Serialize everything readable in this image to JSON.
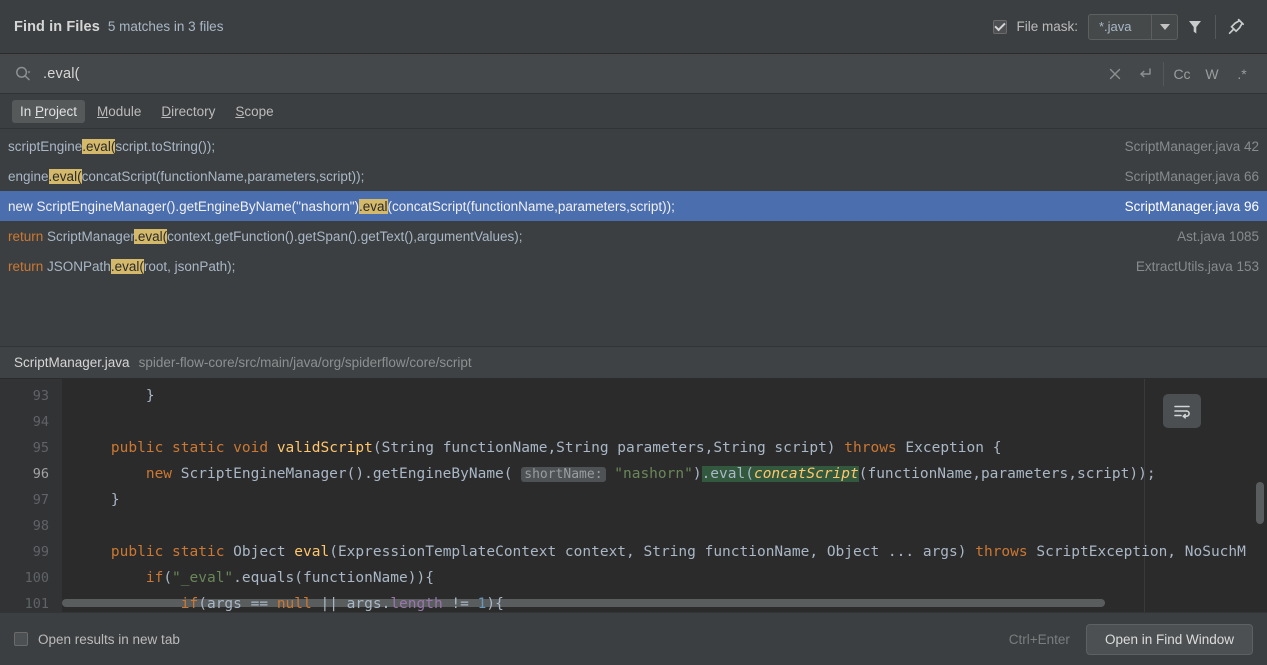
{
  "window": {
    "title": "Find in Files",
    "match_summary": "5 matches in 3 files"
  },
  "file_mask": {
    "checkbox_checked": true,
    "label": "File mask:",
    "value": "*.java",
    "dropdown_icon": "chevron-down-icon"
  },
  "title_actions": {
    "filter_icon": "filter-icon",
    "pin_icon": "pin-icon"
  },
  "search": {
    "icon": "search-icon",
    "value": ".eval(",
    "clear_icon": "close-icon",
    "newline_icon": "return-icon",
    "match_case": "Cc",
    "whole_words": "W",
    "regex": ".*"
  },
  "scope_tabs": [
    {
      "prefix": "In ",
      "mnemonic": "P",
      "suffix": "roject",
      "active": true
    },
    {
      "prefix": "",
      "mnemonic": "M",
      "suffix": "odule",
      "active": false
    },
    {
      "prefix": "",
      "mnemonic": "D",
      "suffix": "irectory",
      "active": false
    },
    {
      "prefix": "",
      "mnemonic": "S",
      "suffix": "cope",
      "active": false
    }
  ],
  "results": [
    {
      "pre": "scriptEngine",
      "match": ".eval(",
      "post": "script.toString());",
      "keyword": "",
      "file": "ScriptManager.java",
      "line": "42",
      "selected": false
    },
    {
      "pre": "engine",
      "match": ".eval(",
      "post": "concatScript(functionName,parameters,script));",
      "keyword": "",
      "file": "ScriptManager.java",
      "line": "66",
      "selected": false
    },
    {
      "pre": "new ScriptEngineManager().getEngineByName(\"nashorn\")",
      "match": ".eval",
      "post": "(concatScript(functionName,parameters,script));",
      "keyword": "",
      "file": "ScriptManager.java",
      "line": "96",
      "selected": true
    },
    {
      "pre": "ScriptManager",
      "match": ".eval(",
      "post": "context.getFunction().getSpan().getText(),argumentValues);",
      "keyword": "return ",
      "file": "Ast.java",
      "line": "1085",
      "selected": false
    },
    {
      "pre": "JSONPath",
      "match": ".eval(",
      "post": "root, jsonPath);",
      "keyword": "return ",
      "file": "ExtractUtils.java",
      "line": "153",
      "selected": false
    }
  ],
  "preview": {
    "file": "ScriptManager.java",
    "path": "spider-flow-core/src/main/java/org/spiderflow/core/script",
    "wrap_icon": "soft-wrap-icon",
    "lines": [
      {
        "num": "93",
        "current": false
      },
      {
        "num": "94",
        "current": false
      },
      {
        "num": "95",
        "current": false
      },
      {
        "num": "96",
        "current": true
      },
      {
        "num": "97",
        "current": false
      },
      {
        "num": "98",
        "current": false
      },
      {
        "num": "99",
        "current": false
      },
      {
        "num": "100",
        "current": false
      },
      {
        "num": "101",
        "current": false
      }
    ],
    "code": {
      "l93": "}",
      "l94": "",
      "l95_public": "public",
      "l95_static": "static",
      "l95_void": "void",
      "l95_name": "validScript",
      "l95_params": "(String functionName,String parameters,String script)",
      "l95_throws": "throws",
      "l95_tail": "Exception {",
      "l96_new": "new",
      "l96_call": "ScriptEngineManager().getEngineByName(",
      "l96_hint": "shortName:",
      "l96_str": "\"nashorn\"",
      "l96_close": ")",
      "l96_match": ".eval(",
      "l96_concat": "concatScript",
      "l96_args": "(functionName,parameters,script)",
      "l96_end": ");",
      "l97": "}",
      "l98": "",
      "l99_public": "public",
      "l99_static": "static",
      "l99_object": "Object",
      "l99_name": "eval",
      "l99_params": "(ExpressionTemplateContext context, String functionName, Object ... args)",
      "l99_throws": "throws",
      "l99_tail": "ScriptException, NoSuchM",
      "l100_if": "if",
      "l100_str": "\"_eval\"",
      "l100_rest": ".equals(functionName)){",
      "l101_if": "if",
      "l101_a": "(args == ",
      "l101_null": "null",
      "l101_b": " || args.",
      "l101_len": "length",
      "l101_c": " != ",
      "l101_num": "1",
      "l101_d": "){"
    }
  },
  "bottom": {
    "open_new_tab_checked": false,
    "open_new_tab_label": "Open results in new tab",
    "shortcut": "Ctrl+Enter",
    "primary_button": "Open in Find Window"
  }
}
